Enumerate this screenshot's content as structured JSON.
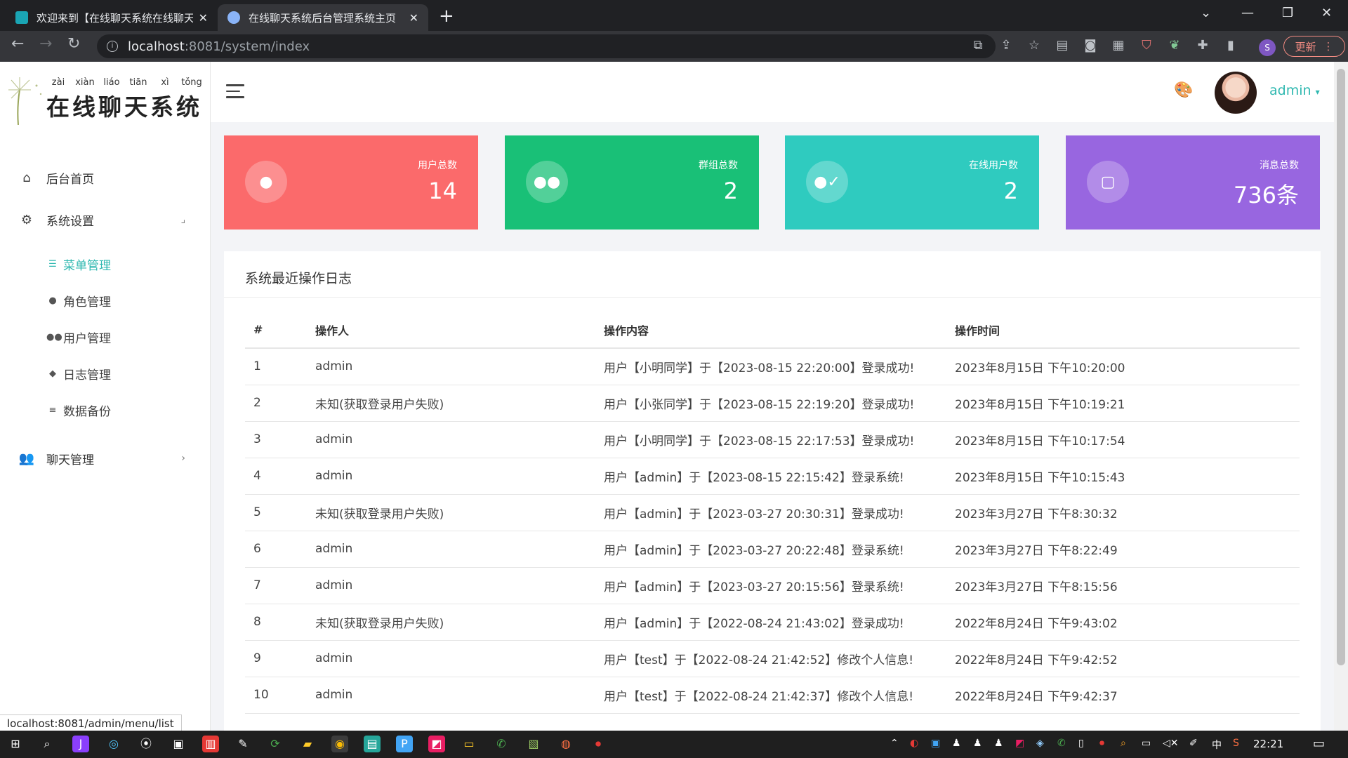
{
  "browser": {
    "tabs": [
      {
        "title": "欢迎来到【在线聊天系统在线聊天",
        "active": false
      },
      {
        "title": "在线聊天系统后台管理系统主页",
        "active": true
      }
    ],
    "url_host": "localhost",
    "url_path": ":8081/system/index",
    "profile_initial": "S",
    "update_label": "更新",
    "status_url": "localhost:8081/admin/menu/list"
  },
  "sidebar": {
    "logo_pinyin": [
      "zài",
      "xiàn",
      "liáo",
      "tiān",
      "xì",
      "tǒng"
    ],
    "logo_text": "在线聊天系统",
    "menu": [
      {
        "label": "后台首页",
        "icon": "home-icon"
      },
      {
        "label": "系统设置",
        "icon": "gear-icon"
      },
      {
        "label": "聊天管理",
        "icon": "users-icon"
      }
    ],
    "submenu": [
      {
        "label": "菜单管理",
        "icon": "list-icon",
        "active": true
      },
      {
        "label": "角色管理",
        "icon": "user-gear-icon",
        "active": false
      },
      {
        "label": "用户管理",
        "icon": "users-icon",
        "active": false
      },
      {
        "label": "日志管理",
        "icon": "tag-icon",
        "active": false
      },
      {
        "label": "数据备份",
        "icon": "database-icon",
        "active": false
      }
    ]
  },
  "header": {
    "user_name": "admin"
  },
  "stats": [
    {
      "label": "用户总数",
      "value": "14",
      "color": "#fb6a6b",
      "icon": "user-icon"
    },
    {
      "label": "群组总数",
      "value": "2",
      "color": "#19c077",
      "icon": "users-icon"
    },
    {
      "label": "在线用户数",
      "value": "2",
      "color": "#2fcbbf",
      "icon": "user-check-icon"
    },
    {
      "label": "消息总数",
      "value": "736条",
      "color": "#9866e0",
      "icon": "chat-icon"
    }
  ],
  "log_panel": {
    "title": "系统最近操作日志",
    "columns": [
      "#",
      "操作人",
      "操作内容",
      "操作时间"
    ],
    "rows": [
      [
        "1",
        "admin",
        "用户【小明同学】于【2023-08-15 22:20:00】登录成功!",
        "2023年8月15日 下午10:20:00"
      ],
      [
        "2",
        "未知(获取登录用户失败)",
        "用户【小张同学】于【2023-08-15 22:19:20】登录成功!",
        "2023年8月15日 下午10:19:21"
      ],
      [
        "3",
        "admin",
        "用户【小明同学】于【2023-08-15 22:17:53】登录成功!",
        "2023年8月15日 下午10:17:54"
      ],
      [
        "4",
        "admin",
        "用户【admin】于【2023-08-15 22:15:42】登录系统!",
        "2023年8月15日 下午10:15:43"
      ],
      [
        "5",
        "未知(获取登录用户失败)",
        "用户【admin】于【2023-03-27 20:30:31】登录成功!",
        "2023年3月27日 下午8:30:32"
      ],
      [
        "6",
        "admin",
        "用户【admin】于【2023-03-27 20:22:48】登录系统!",
        "2023年3月27日 下午8:22:49"
      ],
      [
        "7",
        "admin",
        "用户【admin】于【2023-03-27 20:15:56】登录系统!",
        "2023年3月27日 下午8:15:56"
      ],
      [
        "8",
        "未知(获取登录用户失败)",
        "用户【admin】于【2022-08-24 21:43:02】登录成功!",
        "2022年8月24日 下午9:43:02"
      ],
      [
        "9",
        "admin",
        "用户【test】于【2022-08-24 21:42:52】修改个人信息!",
        "2022年8月24日 下午9:42:52"
      ],
      [
        "10",
        "admin",
        "用户【test】于【2022-08-24 21:42:37】修改个人信息!",
        "2022年8月24日 下午9:42:37"
      ]
    ]
  },
  "taskbar": {
    "ime": "中",
    "clock": "22:21"
  }
}
